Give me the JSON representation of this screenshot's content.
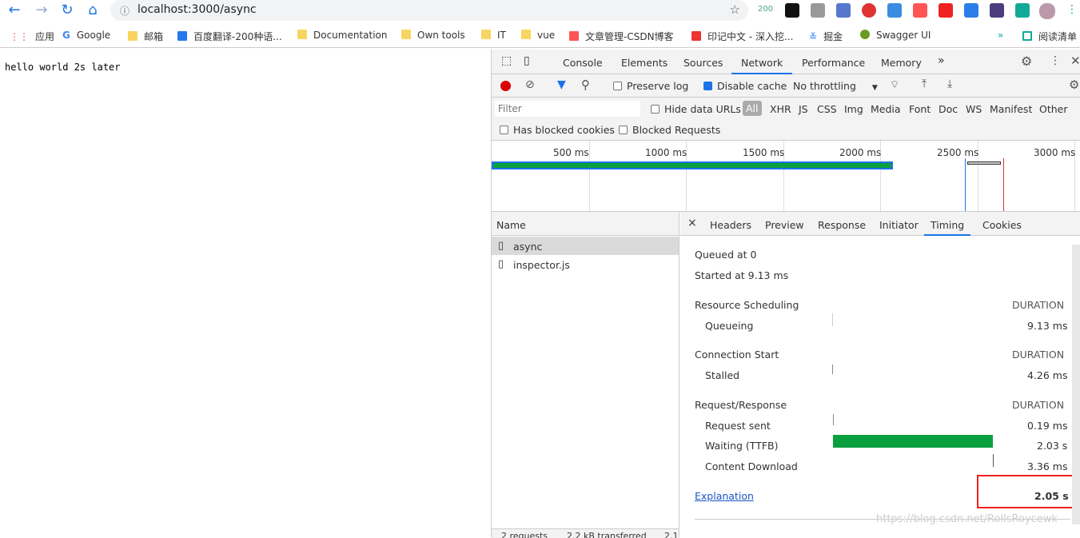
{
  "browser": {
    "url": "localhost:3000/async",
    "ext_badge": "200",
    "bookmarks": [
      "应用",
      "Google",
      "邮箱",
      "百度翻译-200种语...",
      "Documentation",
      "Own tools",
      "IT",
      "vue",
      "文章管理-CSDN博客",
      "印记中文 - 深入挖...",
      "掘金",
      "Swagger UI",
      "阅读清单"
    ],
    "more": "»"
  },
  "page": {
    "text": "hello world 2s later"
  },
  "devtools": {
    "tabs": [
      "Console",
      "Elements",
      "Sources",
      "Network",
      "Performance",
      "Memory"
    ],
    "active_tab": "Network",
    "more_tabs": "»",
    "toolbar": {
      "preserve_log": "Preserve log",
      "disable_cache": "Disable cache",
      "throttling": "No throttling"
    },
    "filter": {
      "placeholder": "Filter",
      "hide_data_urls": "Hide data URLs",
      "types": [
        "All",
        "XHR",
        "JS",
        "CSS",
        "Img",
        "Media",
        "Font",
        "Doc",
        "WS",
        "Manifest",
        "Other"
      ],
      "blocked_cookies": "Has blocked cookies",
      "blocked_requests": "Blocked Requests"
    },
    "overview": {
      "ticks": [
        "500 ms",
        "1000 ms",
        "1500 ms",
        "2000 ms",
        "2500 ms",
        "3000 ms"
      ]
    },
    "requests": {
      "header": "Name",
      "items": [
        "async",
        "inspector.js"
      ],
      "status": [
        "2 requests",
        "2.2 kB transferred",
        "2.1"
      ]
    },
    "detail_tabs": [
      "Headers",
      "Preview",
      "Response",
      "Initiator",
      "Timing",
      "Cookies"
    ],
    "active_detail_tab": "Timing",
    "timing": {
      "queued": "Queued at 0",
      "started": "Started at 9.13 ms",
      "sections": [
        {
          "title": "Resource Scheduling",
          "duration": "DURATION",
          "rows": [
            {
              "label": "Queueing",
              "value": "9.13 ms"
            }
          ]
        },
        {
          "title": "Connection Start",
          "duration": "DURATION",
          "rows": [
            {
              "label": "Stalled",
              "value": "4.26 ms"
            }
          ]
        },
        {
          "title": "Request/Response",
          "duration": "DURATION",
          "rows": [
            {
              "label": "Request sent",
              "value": "0.19 ms"
            },
            {
              "label": "Waiting (TTFB)",
              "value": "2.03 s"
            },
            {
              "label": "Content Download",
              "value": "3.36 ms"
            }
          ]
        }
      ],
      "explanation": "Explanation",
      "total": "2.05 s",
      "ttfb_color": "#0a9f3f"
    },
    "watermark": "https://blog.csdn.net/RollsRoycewk"
  }
}
